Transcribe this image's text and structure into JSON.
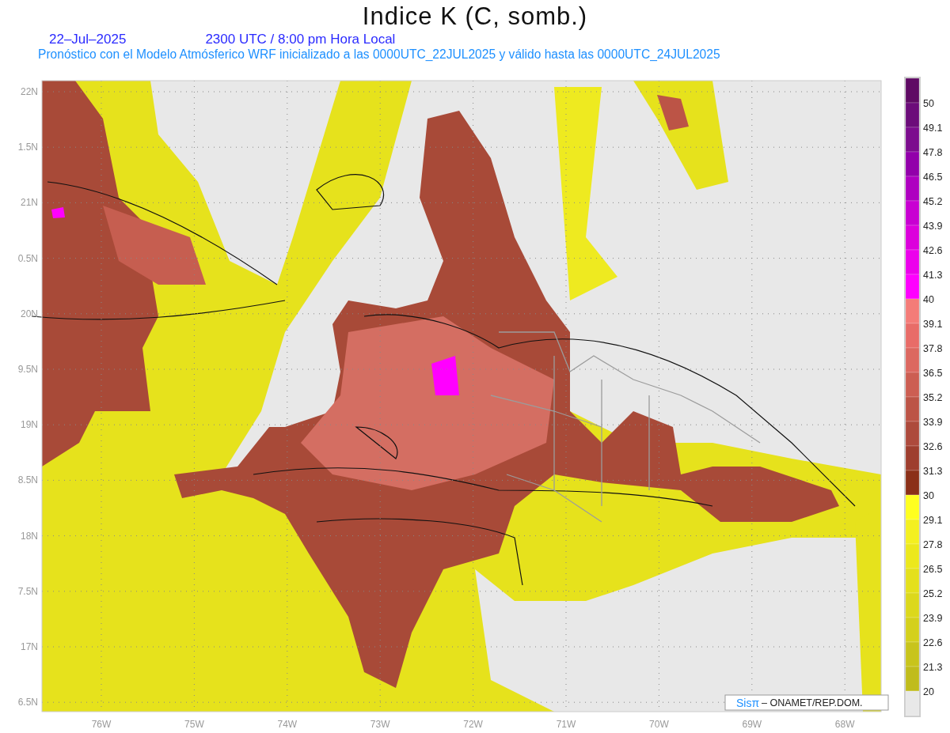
{
  "title": "Indice K (C, somb.)",
  "date": "22–Jul–2025",
  "time": "2300 UTC / 8:00 pm Hora Local",
  "subtitle": "Pronóstico con el Modelo Atmósferico WRF inicializado a las 0000UTC_22JUL2025 y válido hasta las  0000UTC_24JUL2025",
  "lat_labels": [
    "22N",
    "1.5N",
    "21N",
    "0.5N",
    "20N",
    "9.5N",
    "19N",
    "8.5N",
    "18N",
    "7.5N",
    "17N",
    "6.5N"
  ],
  "lon_labels": [
    "76W",
    "75W",
    "74W",
    "73W",
    "72W",
    "71W",
    "70W",
    "69W",
    "68W"
  ],
  "colorbar": {
    "bins": [
      {
        "color": "#5f0a64",
        "label": "50"
      },
      {
        "color": "#6c0c7a",
        "label": "49.1"
      },
      {
        "color": "#7c0c8e",
        "label": "47.8"
      },
      {
        "color": "#9200aa",
        "label": "46.5"
      },
      {
        "color": "#ae00c0",
        "label": "45.2"
      },
      {
        "color": "#c800d2",
        "label": "43.9"
      },
      {
        "color": "#dc00dc",
        "label": "42.6"
      },
      {
        "color": "#ec00ec",
        "label": "41.3"
      },
      {
        "color": "#ff00ff",
        "label": "40"
      },
      {
        "color": "#f47c78",
        "label": "39.1"
      },
      {
        "color": "#e86c68",
        "label": "37.8"
      },
      {
        "color": "#dc6860",
        "label": "36.5"
      },
      {
        "color": "#cc5e52",
        "label": "35.2"
      },
      {
        "color": "#bc5446",
        "label": "33.9"
      },
      {
        "color": "#ad4a3c",
        "label": "32.6"
      },
      {
        "color": "#9e3e2e",
        "label": "31.3"
      },
      {
        "color": "#8b3018",
        "label": "30"
      },
      {
        "color": "#ffff20",
        "label": "29.1"
      },
      {
        "color": "#f4f020",
        "label": "27.8"
      },
      {
        "color": "#ece81c",
        "label": "26.5"
      },
      {
        "color": "#e4e01c",
        "label": "25.2"
      },
      {
        "color": "#dcd81c",
        "label": "23.9"
      },
      {
        "color": "#d4d01c",
        "label": "22.6"
      },
      {
        "color": "#c8c41c",
        "label": "21.3"
      },
      {
        "color": "#c0bc1c",
        "label": "20"
      },
      {
        "color": "#e8e8e8"
      }
    ]
  },
  "credit": {
    "logo": "Sisπ",
    "text": "– ONAMET/REP.DOM."
  }
}
